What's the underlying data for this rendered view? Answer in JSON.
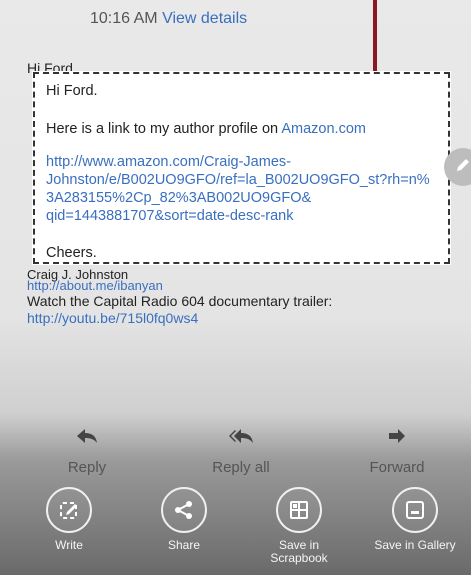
{
  "header": {
    "time": "10:16 AM",
    "details_link": "View details"
  },
  "background": {
    "greeting_partial": "Hi Ford",
    "signature_partial": "Craig J. Johnston",
    "signature_link": "http://about.me/ibanyan",
    "trailer_text": "Watch the Capital Radio 604 documentary trailer: ",
    "trailer_link": "http://youtu.be/715l0fq0ws4"
  },
  "popup": {
    "greeting": "Hi Ford.",
    "intro_text": "Here is a link to my author profile on ",
    "intro_link": "Amazon.com",
    "url_line1": "http://www.amazon.com/Craig-James-",
    "url_line2": "Johnston/e/B002UO9GFO/ref=la_B002UO9GFO_st?rh=n%",
    "url_line3": "3A283155%2Cp_82%3AB002UO9GFO&",
    "url_line4": "qid=1443881707&sort=date-desc-rank",
    "closing": "Cheers."
  },
  "actions": {
    "reply": "Reply",
    "reply_all": "Reply all",
    "forward": "Forward"
  },
  "tools": {
    "write": "Write",
    "share": "Share",
    "scrapbook": "Save in Scrapbook",
    "gallery": "Save in Gallery"
  },
  "colors": {
    "link": "#3a6fbf",
    "callout": "#8a1822"
  },
  "icons": {
    "reply": "reply-icon",
    "reply_all": "reply-all-icon",
    "forward": "forward-icon",
    "write": "write-icon",
    "share": "share-icon",
    "scrapbook": "scrapbook-icon",
    "gallery": "gallery-icon",
    "edit": "edit-pencil-icon"
  }
}
